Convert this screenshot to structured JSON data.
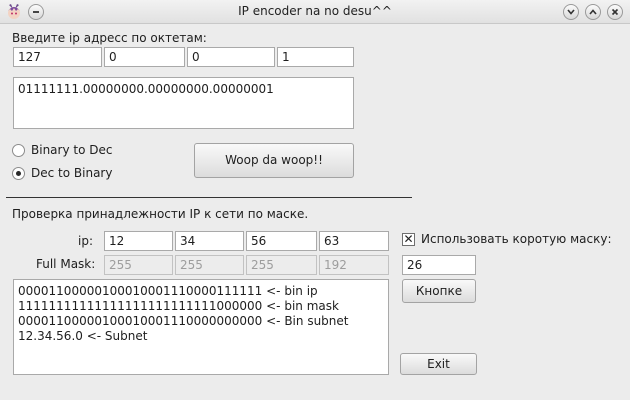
{
  "window": {
    "title": "IP encoder na no desu^^",
    "title_icons": [
      "app-icon",
      "window-menu-icon",
      "minimize-icon",
      "maximize-icon",
      "close-icon"
    ]
  },
  "encoder": {
    "prompt": "Введите ip адресс по октетам:",
    "octets": [
      "127",
      "0",
      "0",
      "1"
    ],
    "output": "01111111.00000000.00000000.00000001",
    "radio_binary_to_dec": "Binary to Dec",
    "radio_dec_to_binary": "Dec to Binary",
    "selected_mode": "Dec to Binary",
    "run_button": "Woop da woop!!"
  },
  "mask_check": {
    "heading": "Проверка принадлежности IP к сети по маске.",
    "ip_label": "ip:",
    "ip_octets": [
      "12",
      "34",
      "56",
      "63"
    ],
    "full_mask_label": "Full Mask:",
    "full_mask_octets": [
      "255",
      "255",
      "255",
      "192"
    ],
    "short_mask_checkbox": "Использовать коротую маску:",
    "short_mask_checked": true,
    "short_mask_value": "26",
    "apply_button": "Кнопке",
    "exit_button": "Exit",
    "output": "00001100000100010001110000111111 <- bin ip\n11111111111111111111111111000000 <- bin mask\n00001100000100010001110000000000 <- Bin subnet\n12.34.56.0 <- Subnet"
  }
}
